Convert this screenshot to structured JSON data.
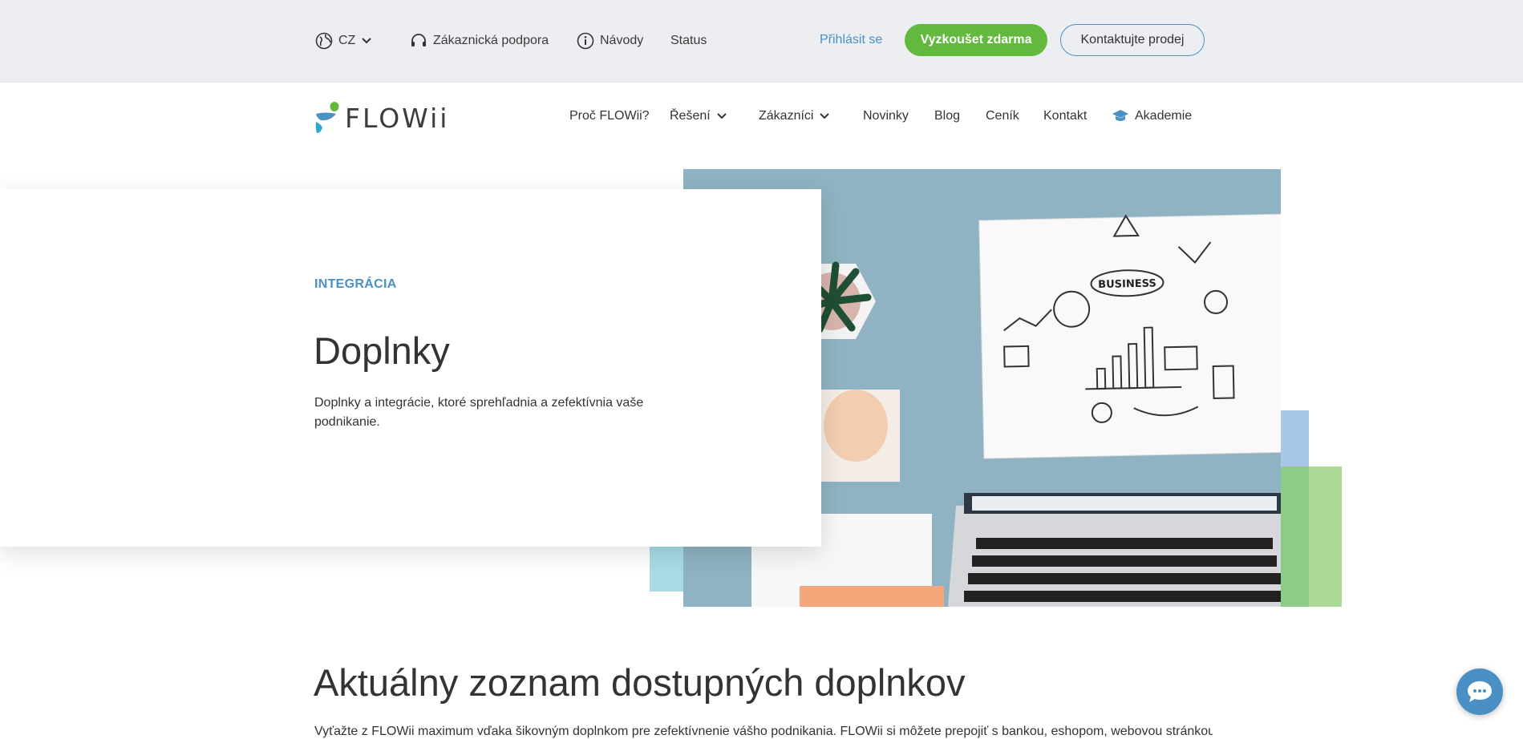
{
  "topbar": {
    "language": "CZ",
    "support": "Zákaznická podpora",
    "guides": "Návody",
    "status": "Status",
    "login": "Přihlásit se",
    "try_free": "Vyzkoušet zdarma",
    "contact_sales": "Kontaktujte prodej"
  },
  "logo": {
    "text": "FLOWii"
  },
  "nav": {
    "why": "Proč FLOWii?",
    "solutions": "Řešení",
    "customers": "Zákazníci",
    "news": "Novinky",
    "blog": "Blog",
    "pricing": "Ceník",
    "contact": "Kontakt",
    "academy": "Akademie"
  },
  "hero": {
    "eyebrow": "INTEGRÁCIA",
    "title": "Doplnky",
    "description": "Doplnky a integrácie, ktoré sprehľadnia a zefektívnia vaše podnikanie.",
    "sketch_label": "BUSINESS"
  },
  "section": {
    "title": "Aktuálny zoznam dostupných doplnkov",
    "intro": "Vyťažte z FLOWii maximum vďaka šikovným doplnkom pre zefektívnenie vášho podnikania. FLOWii si môžete prepojiť s bankou, eshopom, webovou stránkou, účtovným"
  },
  "colors": {
    "accent_blue": "#4a90c4",
    "accent_green": "#63b93d",
    "topbar_bg": "#eceef1"
  }
}
